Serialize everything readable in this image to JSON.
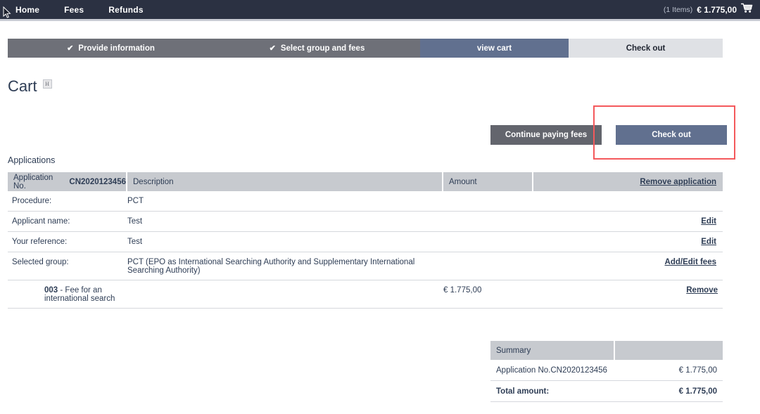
{
  "topbar": {
    "nav": [
      {
        "label": "Home",
        "name": "nav-home"
      },
      {
        "label": "Fees",
        "name": "nav-fees"
      },
      {
        "label": "Refunds",
        "name": "nav-refunds"
      }
    ],
    "cart_count": "(1 Items)",
    "cart_amount": "€ 1.775,00",
    "cart_icon": "shopping-cart-icon",
    "cart_glyph": "🛒"
  },
  "steps": [
    {
      "label": "Provide information",
      "state": "done",
      "tick": "✔"
    },
    {
      "label": "Select group and fees",
      "state": "done",
      "tick": "✔"
    },
    {
      "label": "view cart",
      "state": "current",
      "tick": ""
    },
    {
      "label": "Check out",
      "state": "todo",
      "tick": ""
    }
  ],
  "page": {
    "title": "Cart",
    "title_badge": "H"
  },
  "actions": {
    "continue_label": "Continue paying fees",
    "checkout_label": "Check out",
    "highlight_color": "#f4595c"
  },
  "applications": {
    "section_label": "Applications",
    "header": {
      "app_no_label": "Application No.",
      "app_no_value": "CN2020123456",
      "description": "Description",
      "amount": "Amount",
      "remove_application": "Remove application"
    },
    "rows": [
      {
        "label": "Procedure:",
        "value": "PCT",
        "amount": "",
        "action": ""
      },
      {
        "label": "Applicant name:",
        "value": "Test",
        "amount": "",
        "action": "Edit"
      },
      {
        "label": "Your reference:",
        "value": "Test",
        "amount": "",
        "action": "Edit"
      },
      {
        "label": "Selected group:",
        "value": "PCT (EPO as International Searching Authority and Supplementary International Searching Authority)",
        "amount": "",
        "action": "Add/Edit fees"
      }
    ],
    "fee_row": {
      "code": "003",
      "description": "- Fee for an international search",
      "amount": "€ 1.775,00",
      "action": "Remove"
    }
  },
  "summary": {
    "title": "Summary",
    "line_label": "Application No.CN2020123456",
    "line_amount": "€ 1.775,00",
    "total_label": "Total amount:",
    "total_amount": "€ 1.775,00"
  }
}
